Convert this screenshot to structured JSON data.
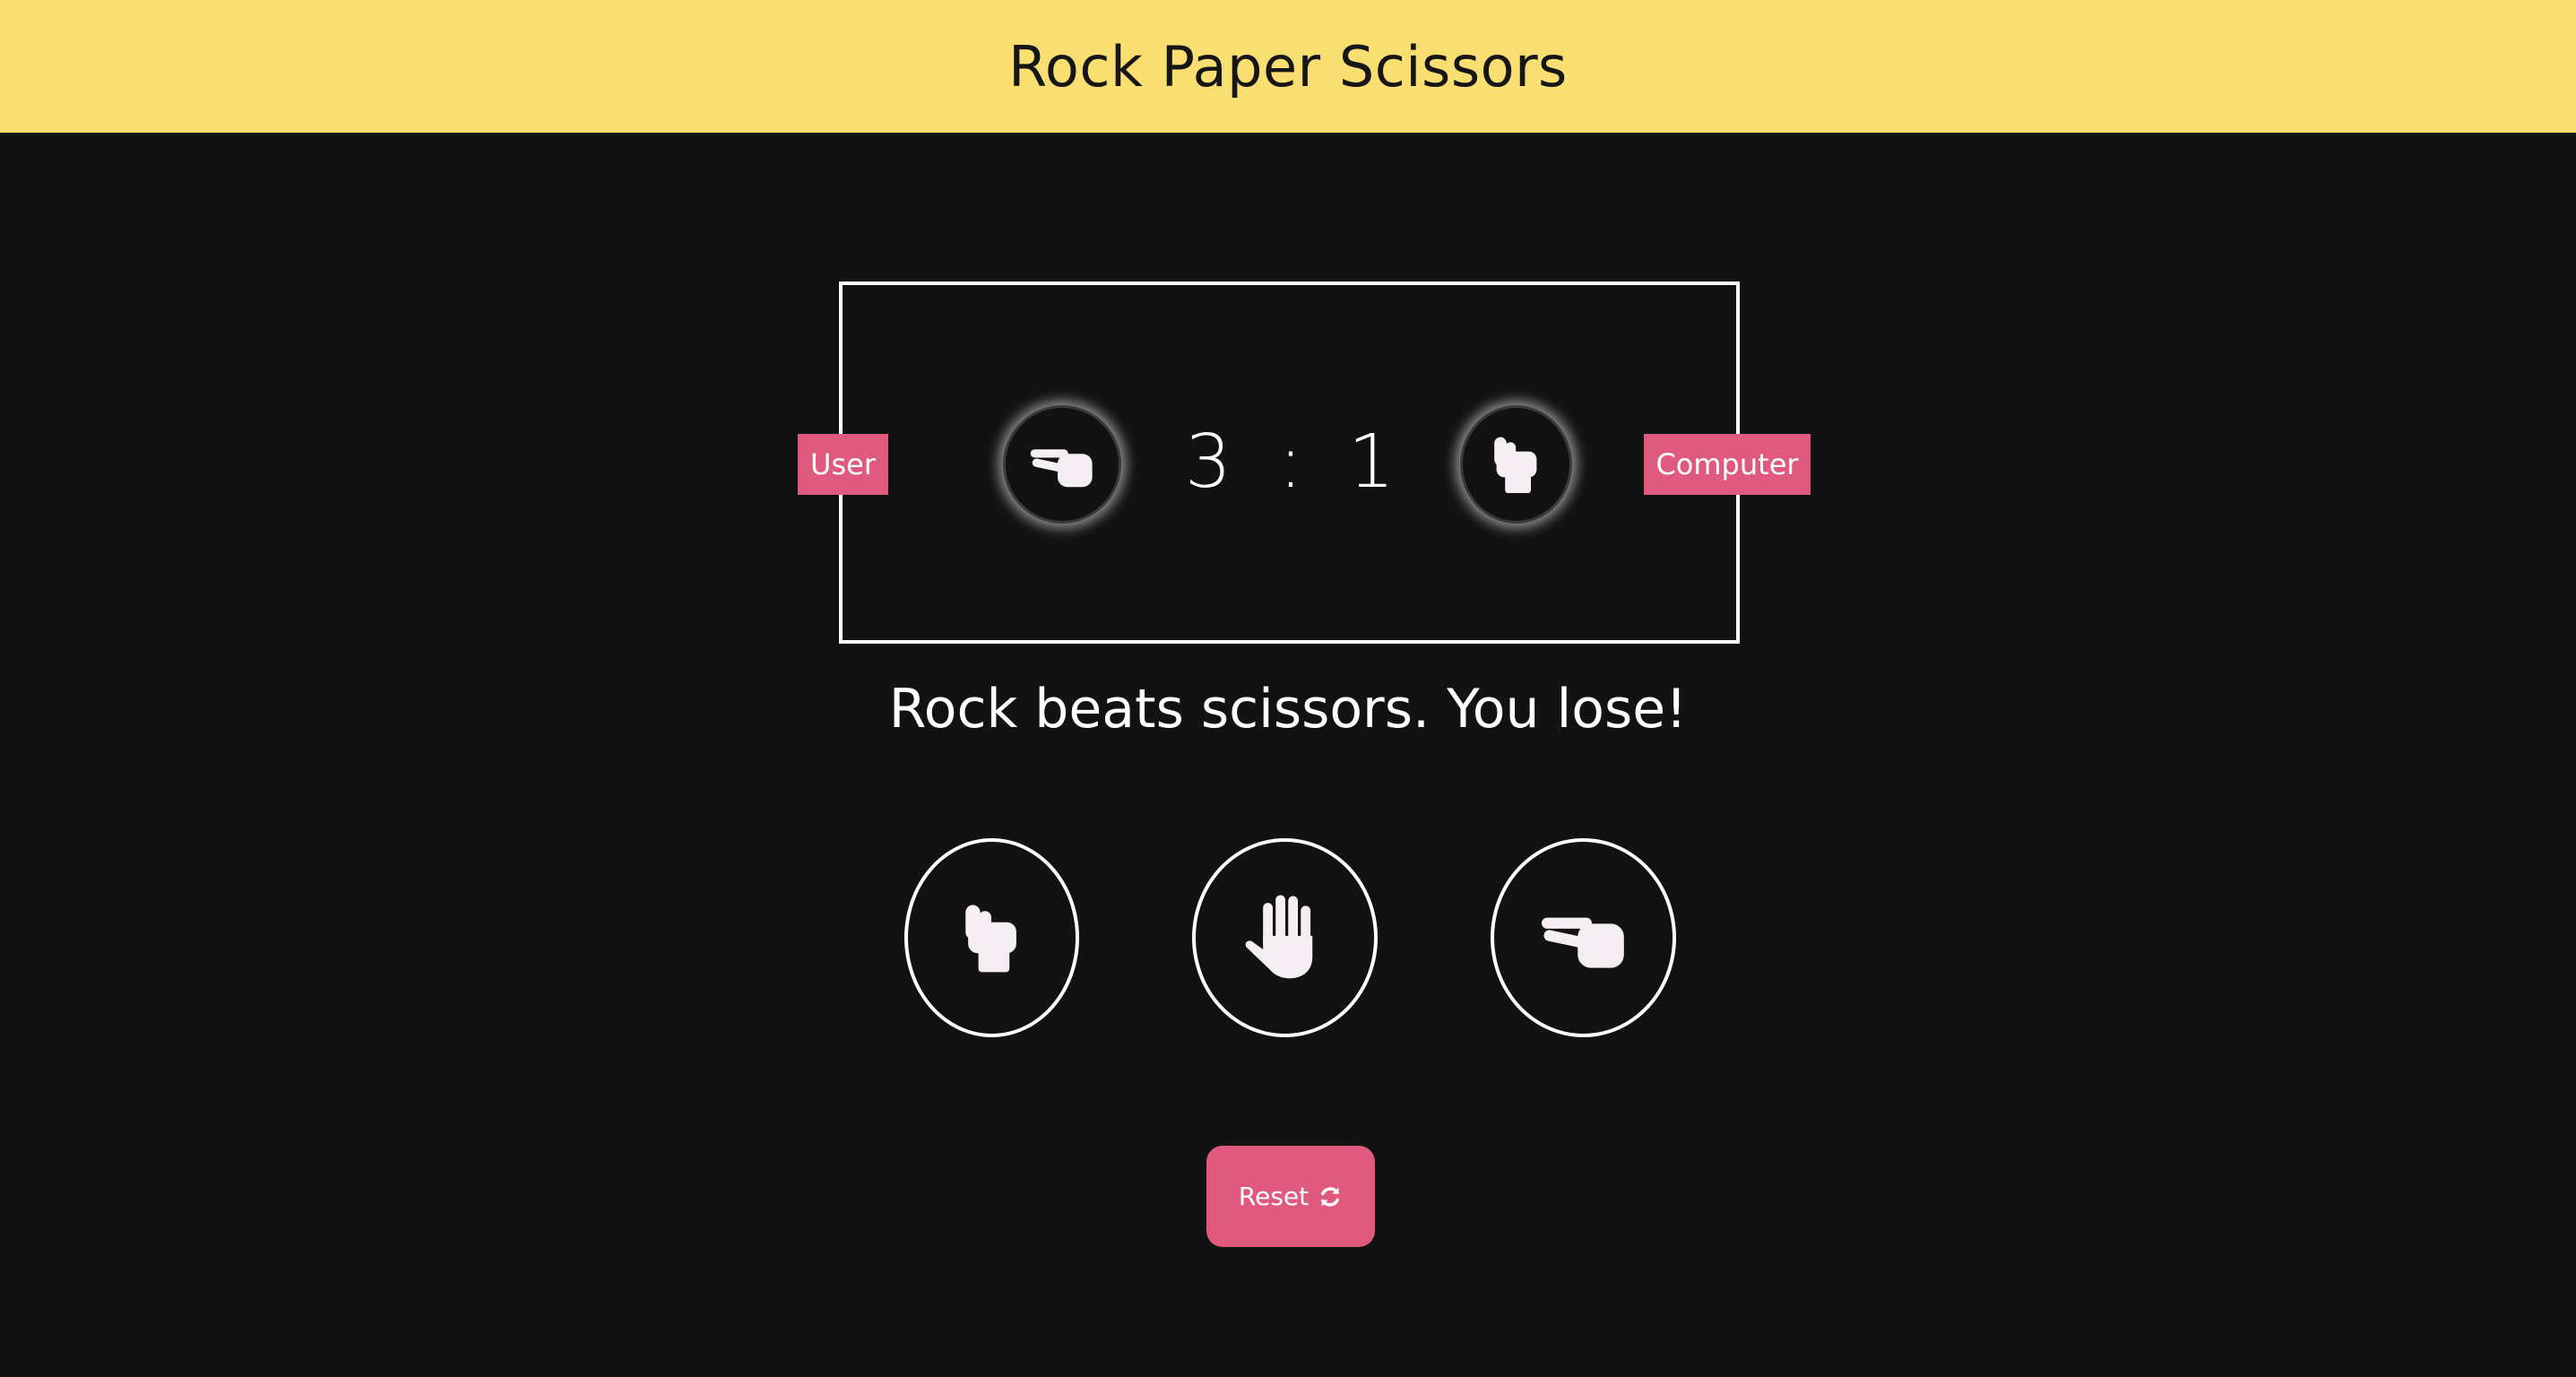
{
  "header": {
    "title": "Rock Paper Scissors"
  },
  "scoreboard": {
    "user_label": "User",
    "computer_label": "Computer",
    "user_score": "3",
    "separator": ":",
    "computer_score": "1",
    "user_choice_icon": "scissors-icon",
    "computer_choice_icon": "rock-icon"
  },
  "result_message": "Rock beats scissors. You lose!",
  "choices": [
    {
      "id": "rock",
      "icon": "rock-icon"
    },
    {
      "id": "paper",
      "icon": "paper-icon"
    },
    {
      "id": "scissors",
      "icon": "scissors-icon"
    }
  ],
  "reset": {
    "label": "Reset",
    "icon": "refresh-icon"
  },
  "colors": {
    "header_bg": "#f9de72",
    "page_bg": "#121212",
    "accent": "#df5a7e",
    "icon": "#f5eff3"
  }
}
